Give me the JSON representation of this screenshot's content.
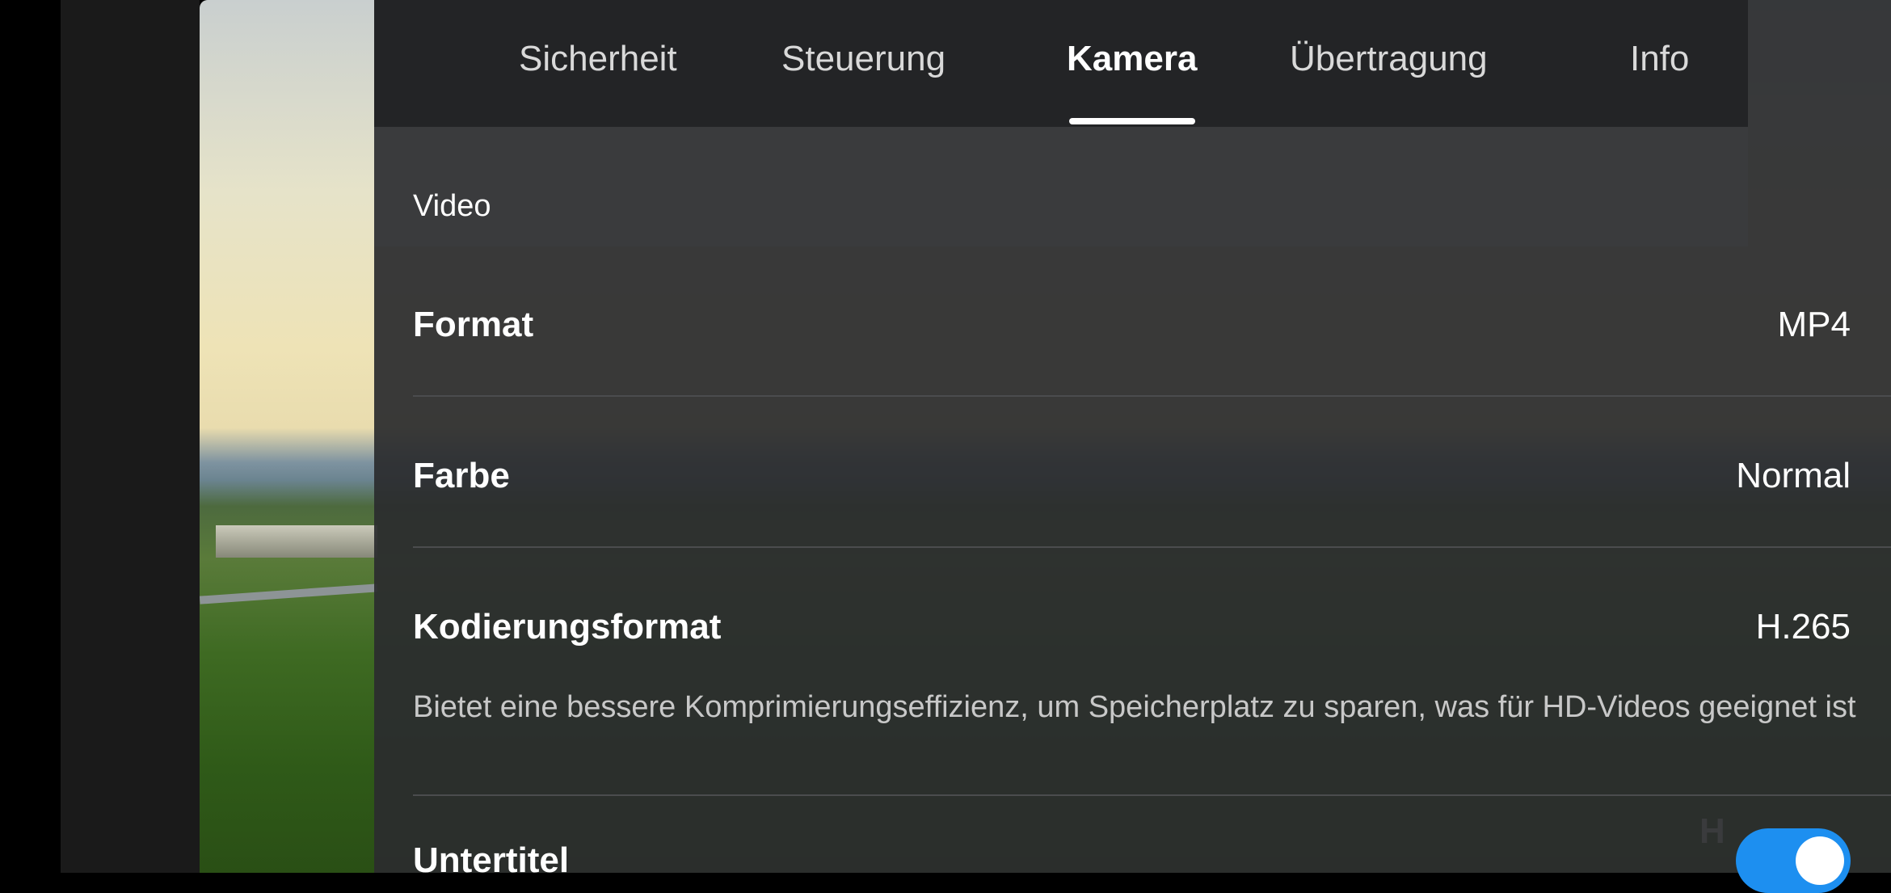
{
  "tabs": [
    {
      "label": "Sicherheit",
      "active": false
    },
    {
      "label": "Steuerung",
      "active": false
    },
    {
      "label": "Kamera",
      "active": true
    },
    {
      "label": "Übertragung",
      "active": false
    },
    {
      "label": "Info",
      "active": false
    }
  ],
  "section": {
    "title": "Video"
  },
  "settings": {
    "format": {
      "label": "Format",
      "value": "MP4"
    },
    "color": {
      "label": "Farbe",
      "value": "Normal"
    },
    "encoding": {
      "label": "Kodierungsformat",
      "value": "H.265",
      "description": "Bietet eine bessere Komprimierungseffizienz, um Speicherplatz zu sparen, was für HD-Videos geeignet ist"
    },
    "subtitles": {
      "label": "Untertitel",
      "enabled": true
    }
  },
  "overlay": {
    "partial_text": "H"
  },
  "colors": {
    "accent": "#1d8ff0",
    "panel": "#2b2c2e",
    "tab_bar": "#232426"
  }
}
